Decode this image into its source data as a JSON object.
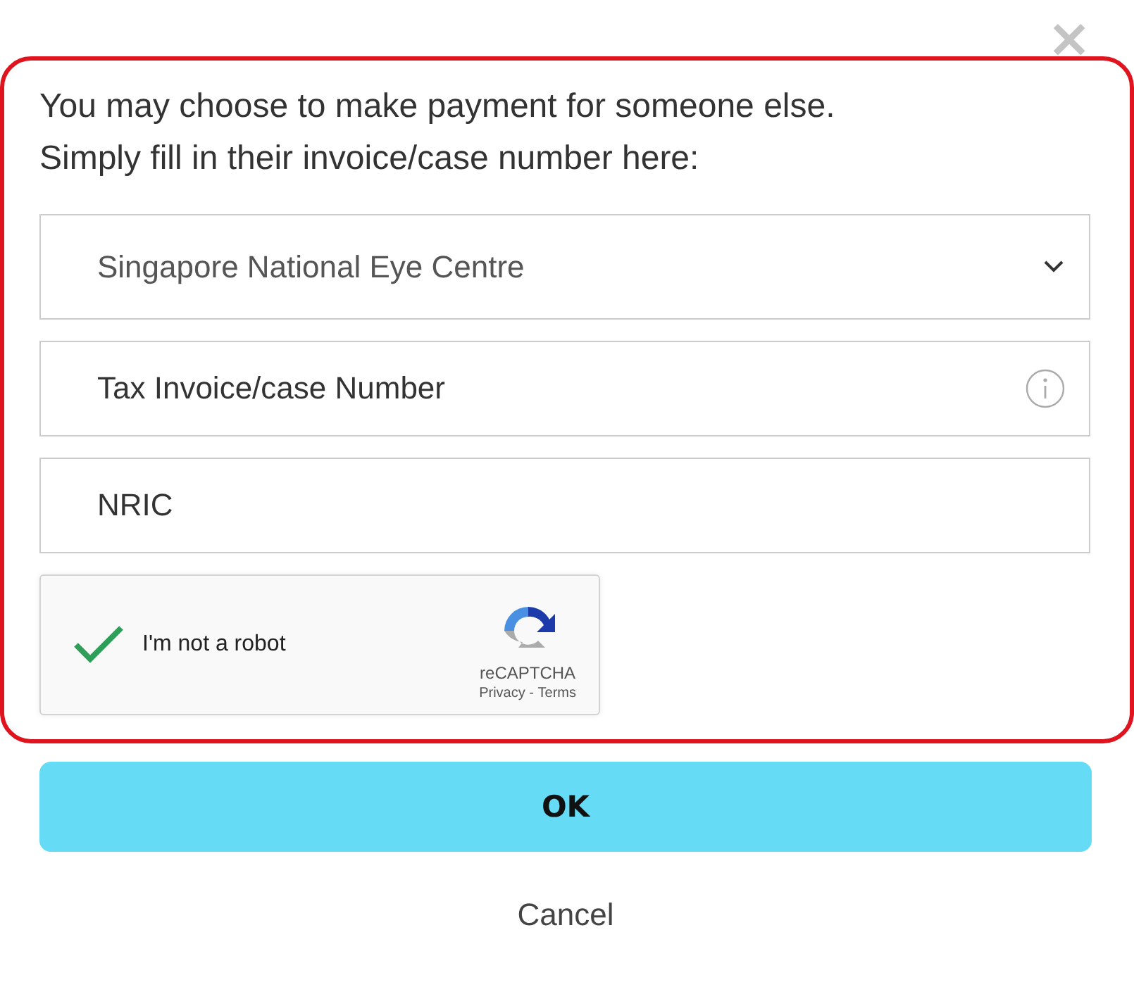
{
  "close_label": "×",
  "intro": [
    "You may choose to make payment for someone else.",
    "Simply fill in their invoice/case number here:"
  ],
  "fields": [
    {
      "kind": "select",
      "value": "Singapore National Eye Centre"
    },
    {
      "kind": "info",
      "placeholder": "Tax Invoice/case Number"
    },
    {
      "kind": "text",
      "placeholder": "NRIC"
    }
  ],
  "captcha": {
    "label": "I'm not a robot",
    "checked": true,
    "brand": "reCAPTCHA",
    "privacy": "Privacy",
    "separator": " - ",
    "terms": "Terms"
  },
  "buttons": [
    {
      "kind": "primary",
      "label": "OK"
    },
    {
      "kind": "plain",
      "label": "Cancel"
    }
  ]
}
